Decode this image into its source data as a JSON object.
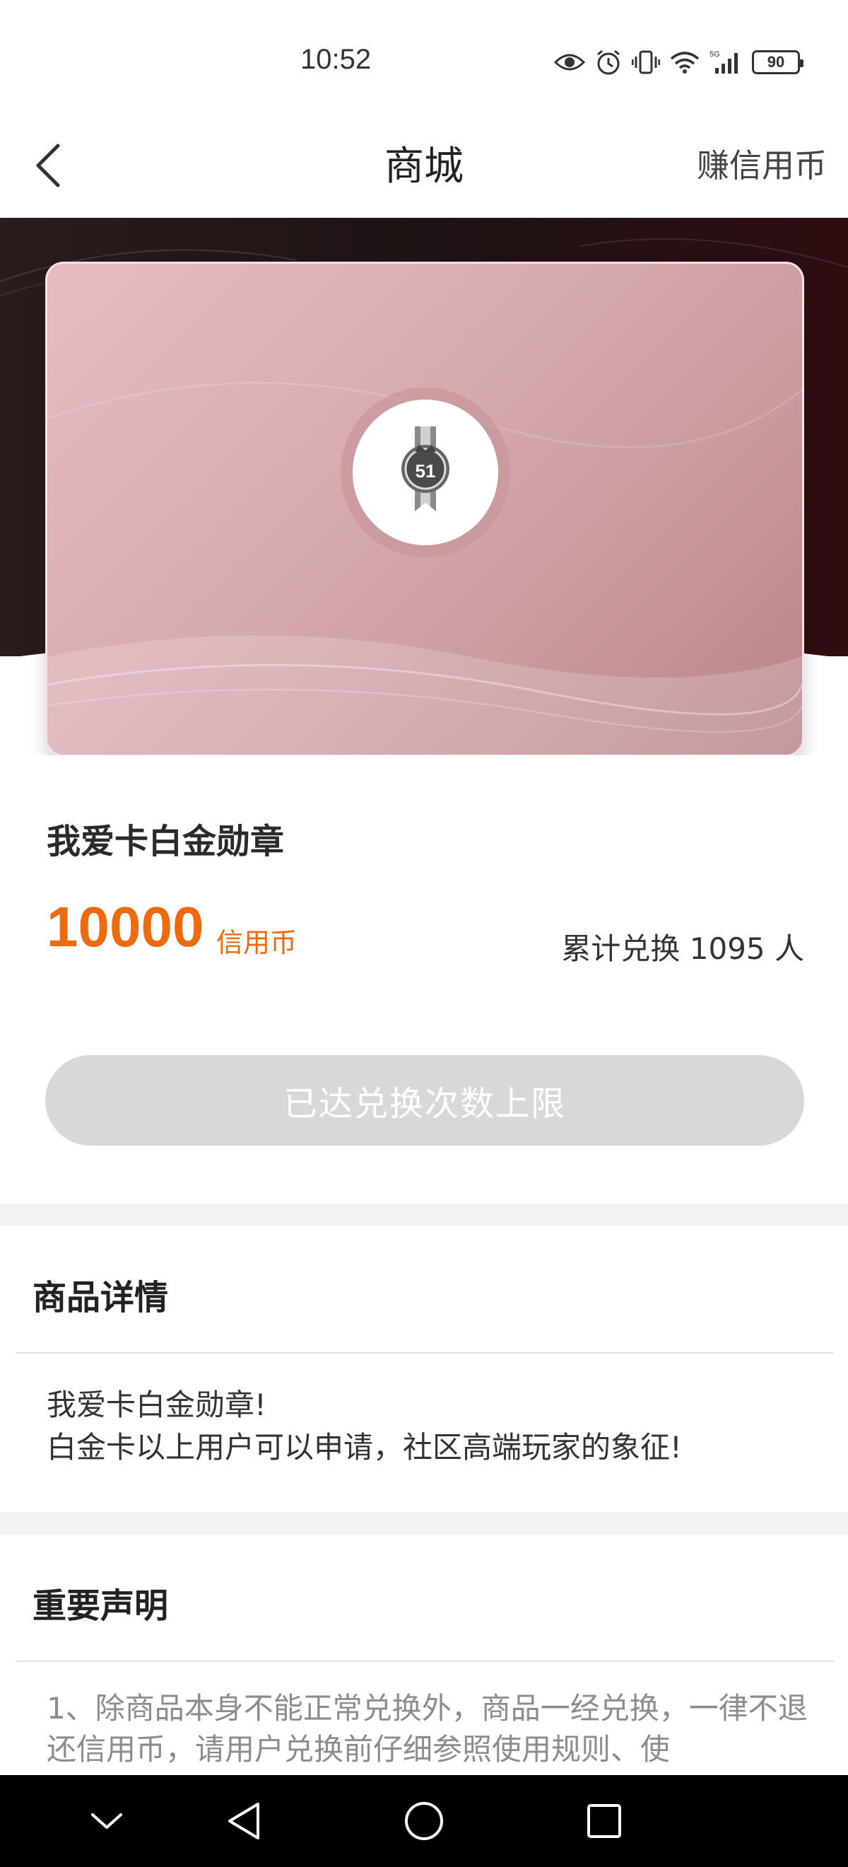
{
  "status_bar": {
    "time": "10:52",
    "battery": "90",
    "network": "5G"
  },
  "nav": {
    "title": "商城",
    "right_action": "赚信用币"
  },
  "product": {
    "name": "我爱卡白金勋章",
    "price": "10000",
    "price_unit": "信用币",
    "exchanged_text": "累计兑换 1095 人",
    "badge_number": "51"
  },
  "redeem_button": {
    "label": "已达兑换次数上限"
  },
  "details": {
    "title": "商品详情",
    "lines": [
      "我爱卡白金勋章!",
      "白金卡以上用户可以申请，社区高端玩家的象征!"
    ]
  },
  "statement": {
    "title": "重要声明",
    "text": "1、除商品本身不能正常兑换外，商品一经兑换，一律不退还信用币，请用户兑换前仔细参照使用规则、使"
  },
  "colors": {
    "accent": "#ee6a0f",
    "disabled_button": "#d8d8d8",
    "card": "#d6a9ae"
  }
}
